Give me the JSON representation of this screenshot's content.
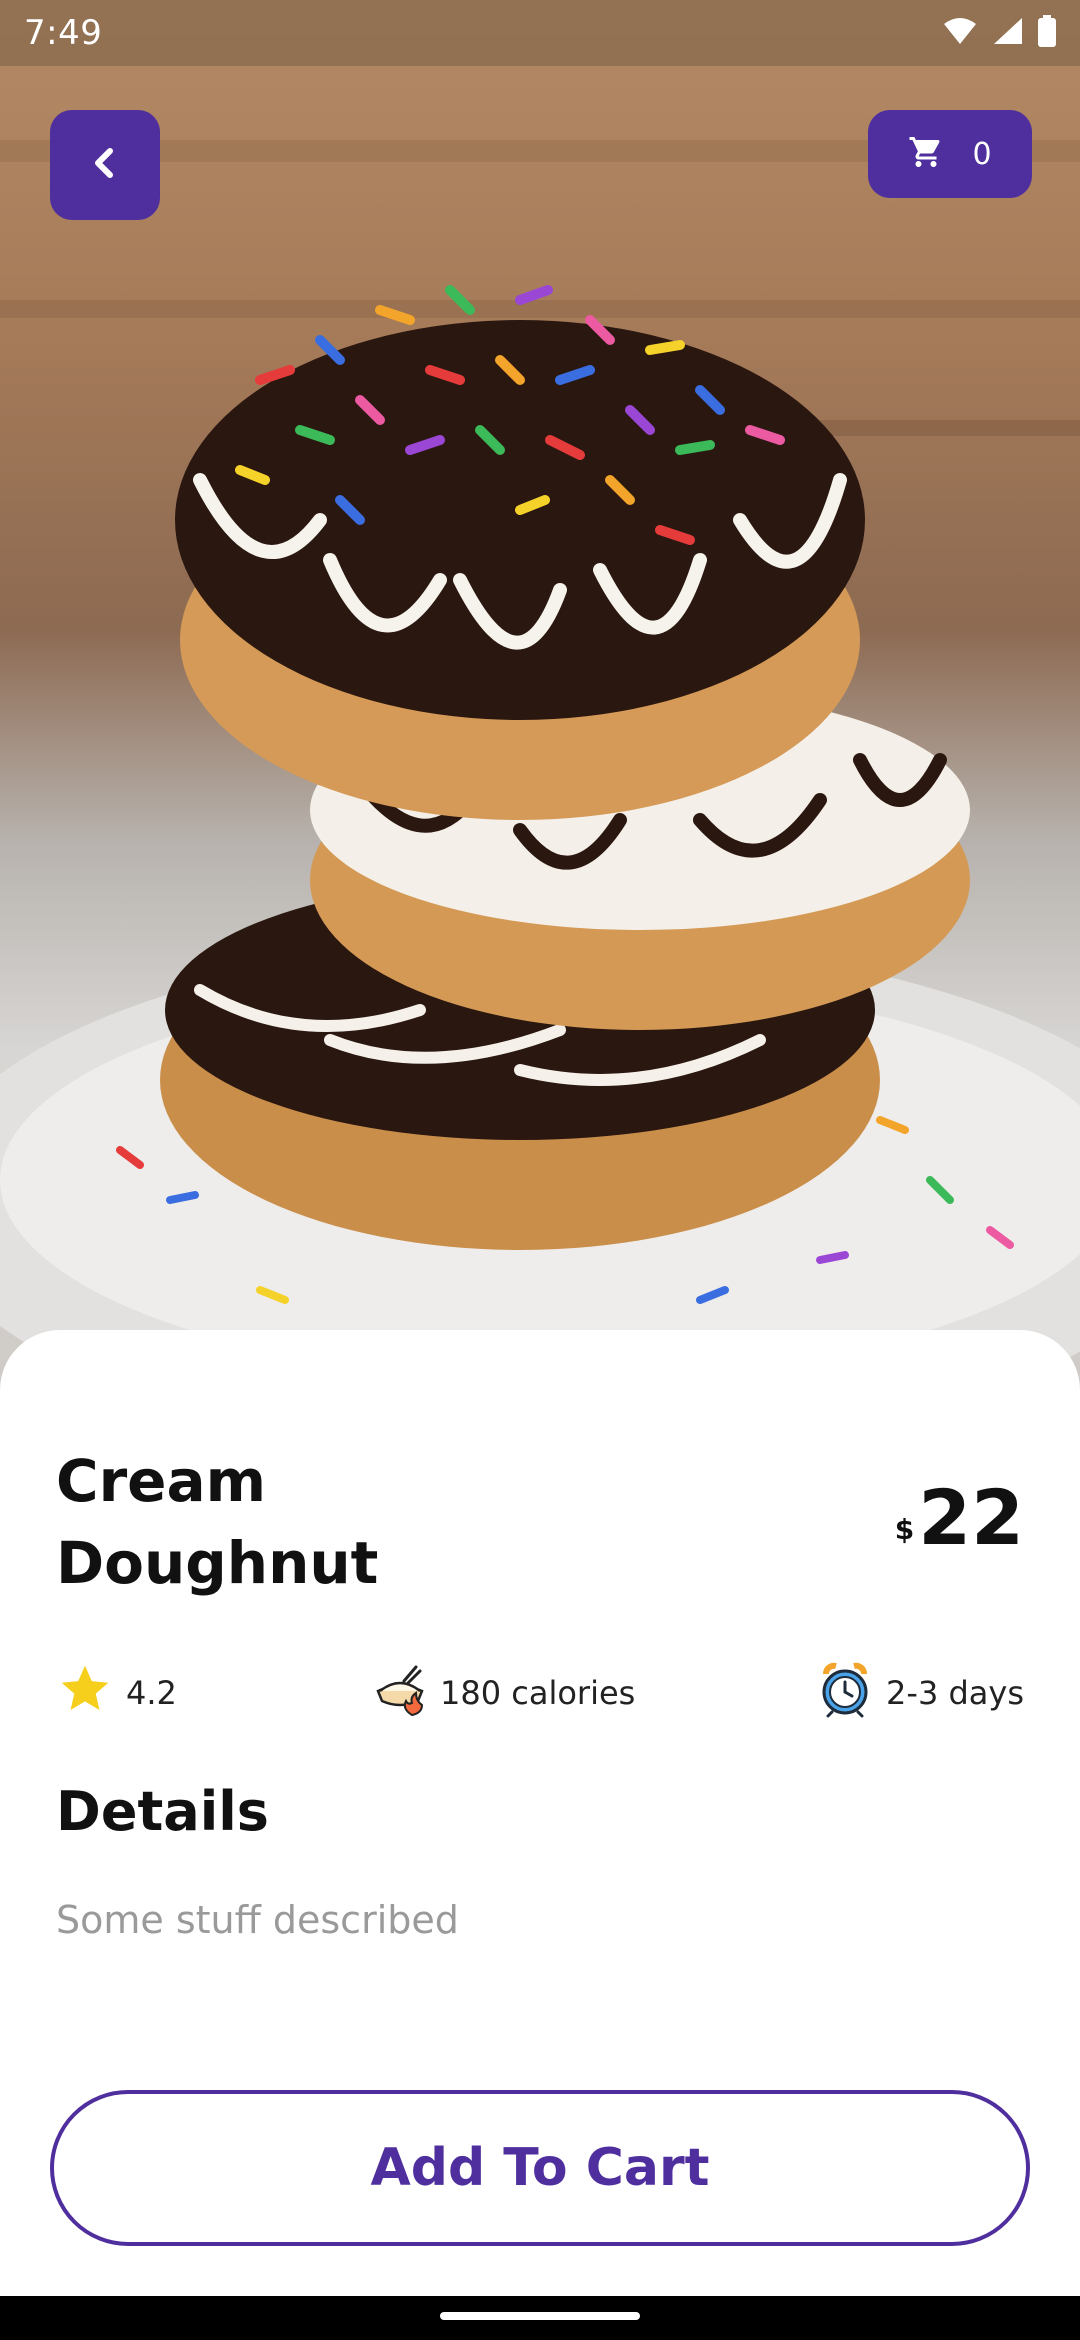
{
  "status_bar": {
    "time": "7:49"
  },
  "cart": {
    "count": "0"
  },
  "product": {
    "name": "Cream Doughnut",
    "currency": "$",
    "price": "22",
    "rating": "4.2",
    "calories": "180 calories",
    "delivery": "2-3 days"
  },
  "details": {
    "title": "Details",
    "text": "Some stuff described"
  },
  "actions": {
    "add_to_cart": "Add To Cart"
  },
  "colors": {
    "accent": "#4f2f9e",
    "star": "#f5cf1b",
    "muted_text": "#9a9a9a"
  },
  "icons": [
    "back-chevron-icon",
    "cart-icon",
    "star-icon",
    "calories-icon",
    "alarm-clock-icon",
    "wifi-icon",
    "signal-icon",
    "battery-icon"
  ]
}
